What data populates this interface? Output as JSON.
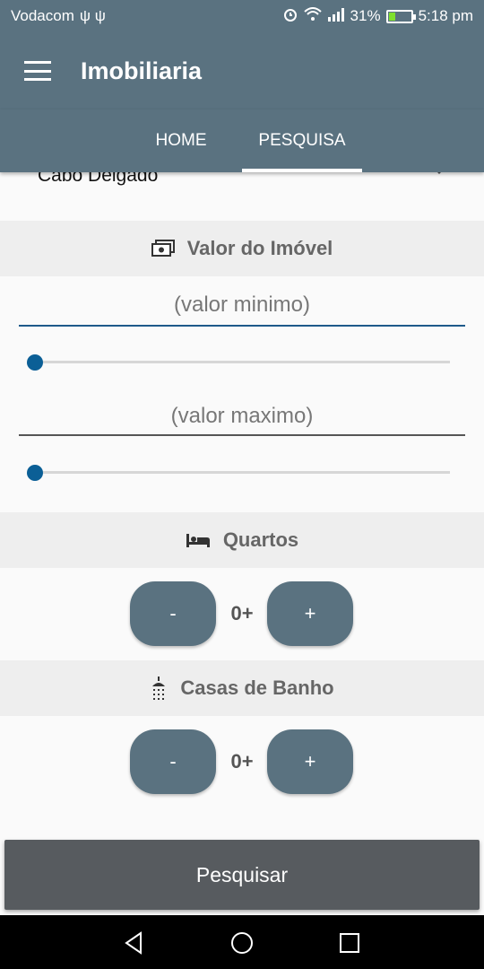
{
  "status_bar": {
    "carrier": "Vodacom",
    "usb_icons": "Ψ Ψ",
    "signal_icons": "⏰",
    "battery_percent": "31%",
    "time": "5:18 pm"
  },
  "app_bar": {
    "title": "Imobiliaria"
  },
  "tabs": [
    {
      "label": "HOME",
      "selected": false
    },
    {
      "label": "PESQUISA",
      "selected": true
    }
  ],
  "location": {
    "selected": "Cabo Delgado"
  },
  "valor": {
    "header": "Valor do Imóvel",
    "min_placeholder": "(valor minimo)",
    "max_placeholder": "(valor maximo)",
    "min_slider_fraction": 0,
    "max_slider_fraction": 0
  },
  "quartos": {
    "header": "Quartos",
    "minus": "-",
    "value": "0+",
    "plus": "+"
  },
  "casas_banho": {
    "header": "Casas de Banho",
    "minus": "-",
    "value": "0+",
    "plus": "+"
  },
  "search_button": "Pesquisar",
  "colors": {
    "primary": "#5a7280",
    "accent": "#0b5f96",
    "button_dark": "#575b5f"
  }
}
